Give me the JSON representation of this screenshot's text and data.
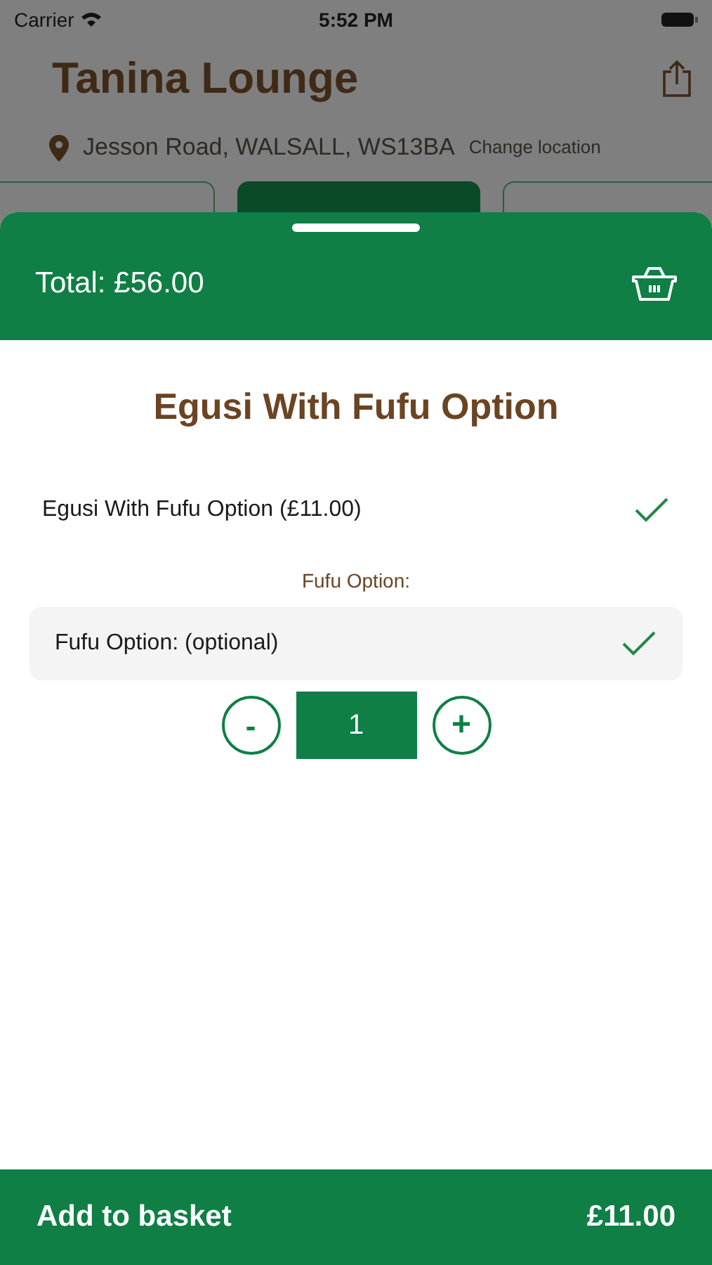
{
  "status_bar": {
    "carrier": "Carrier",
    "time": "5:52 PM"
  },
  "restaurant": {
    "name": "Tanina Lounge",
    "address": "Jesson Road, WALSALL, WS13BA",
    "change_location": "Change location"
  },
  "category_tabs": [
    {
      "selected": false
    },
    {
      "selected": true
    },
    {
      "selected": false
    }
  ],
  "sheet": {
    "total": "Total: £56.00",
    "title": "Egusi With Fufu Option",
    "items": [
      {
        "label": "Egusi With Fufu Option (£11.00)",
        "checked": true
      }
    ],
    "option_heading": "Fufu Option:",
    "options": [
      {
        "label": "Fufu Option: (optional)",
        "checked": true
      }
    ],
    "quantity": {
      "minus": "-",
      "value": "1",
      "plus": "+"
    },
    "add_button": {
      "label": "Add to basket",
      "price": "£11.00"
    }
  }
}
